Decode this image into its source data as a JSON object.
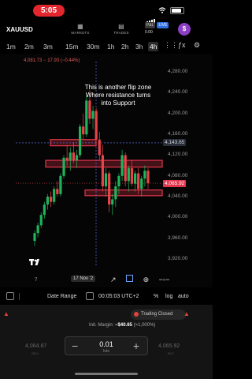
{
  "status_bar": {
    "time": "5:05"
  },
  "nav": {
    "symbol": "XAUUSD",
    "markets_label": "MARKETS",
    "trades_label": "TRADES",
    "pnl_badge": "P&L",
    "live_badge": "LIVE",
    "balance": "0.00",
    "dollar_icon": "$"
  },
  "timeframes": {
    "items": [
      "1m",
      "2m",
      "3m",
      "15m",
      "30m",
      "1h",
      "2h",
      "3h",
      "4h"
    ],
    "active": "4h"
  },
  "chart": {
    "ohlc_line": "4,081.73 − 17.93 (−0.44%)",
    "annotation_line1": "This is another flip zone",
    "annotation_line2": "Where resistance turns",
    "annotation_line3": "into Support",
    "price_tag_blue": "4,143.65",
    "price_tag_red": "4,065.92",
    "logo_text": "TV",
    "day_label": "7",
    "date_chip": "17 Nov '2"
  },
  "chart_data": {
    "type": "candlestick",
    "symbol": "XAUUSD",
    "timeframe": "4h",
    "y_ticks": [
      "4,280.00",
      "4,240.00",
      "4,200.00",
      "4,160.00",
      "4,120.00",
      "4,080.00",
      "4,040.00",
      "4,000.00",
      "3,960.00",
      "3,920.00"
    ],
    "ylim": [
      3905,
      4300
    ],
    "current_price": 4065.92,
    "crosshair_price": 4143.65,
    "zones": [
      {
        "name": "upper-small",
        "top": 4150,
        "bottom": 4138
      },
      {
        "name": "middle",
        "top": 4110,
        "bottom": 4097
      },
      {
        "name": "lower",
        "top": 4053,
        "bottom": 4042
      }
    ],
    "candles": [
      [
        3955,
        3975,
        3945,
        3970
      ],
      [
        3970,
        3990,
        3962,
        3985
      ],
      [
        3985,
        4010,
        3980,
        4005
      ],
      [
        4005,
        4030,
        3998,
        4025
      ],
      [
        4025,
        4045,
        4015,
        4040
      ],
      [
        4040,
        4050,
        4020,
        4030
      ],
      [
        4030,
        4060,
        4025,
        4055
      ],
      [
        4055,
        4070,
        4040,
        4045
      ],
      [
        4045,
        4085,
        4040,
        4080
      ],
      [
        4080,
        4120,
        4075,
        4115
      ],
      [
        4115,
        4140,
        4100,
        4110
      ],
      [
        4110,
        4135,
        4090,
        4125
      ],
      [
        4125,
        4145,
        4105,
        4110
      ],
      [
        4110,
        4130,
        4095,
        4120
      ],
      [
        4120,
        4180,
        4115,
        4175
      ],
      [
        4175,
        4200,
        4150,
        4160
      ],
      [
        4160,
        4235,
        4155,
        4225
      ],
      [
        4225,
        4245,
        4180,
        4190
      ],
      [
        4190,
        4215,
        4170,
        4205
      ],
      [
        4205,
        4210,
        4140,
        4150
      ],
      [
        4150,
        4165,
        4110,
        4120
      ],
      [
        4120,
        4140,
        4050,
        4060
      ],
      [
        4060,
        4095,
        4040,
        4085
      ],
      [
        4085,
        4090,
        4010,
        4025
      ],
      [
        4025,
        4045,
        4005,
        4035
      ],
      [
        4035,
        4070,
        4020,
        4060
      ],
      [
        4060,
        4085,
        4045,
        4080
      ],
      [
        4080,
        4130,
        4070,
        4120
      ],
      [
        4120,
        4125,
        4060,
        4070
      ],
      [
        4070,
        4100,
        4050,
        4095
      ],
      [
        4095,
        4110,
        4060,
        4065
      ],
      [
        4065,
        4090,
        4050,
        4085
      ],
      [
        4085,
        4095,
        4045,
        4055
      ],
      [
        4055,
        4080,
        4040,
        4075
      ],
      [
        4075,
        4100,
        4060,
        4090
      ],
      [
        4090,
        4095,
        4055,
        4066
      ]
    ]
  },
  "controls": {
    "date_range": "Date Range",
    "timezone": "00:05:03 UTC+2",
    "percent": "%",
    "log": "log",
    "auto": "auto"
  },
  "trade_panel": {
    "status": "Trading Closed",
    "margin_label": "Init. Margin:",
    "margin_value": "−$40.65",
    "margin_pct": "(>1,000%)",
    "sell_price": "4,064.87",
    "buy_price": "4,065.92",
    "sell_label": "SELL",
    "buy_label": "BUY",
    "lot_value": "0.01",
    "lot_unit": "lots",
    "minus": "−",
    "plus": "+"
  },
  "colors": {
    "bull": "#1fb35b",
    "bear": "#e8434a",
    "zone": "#e3364d",
    "accent": "#2f6fe0"
  }
}
